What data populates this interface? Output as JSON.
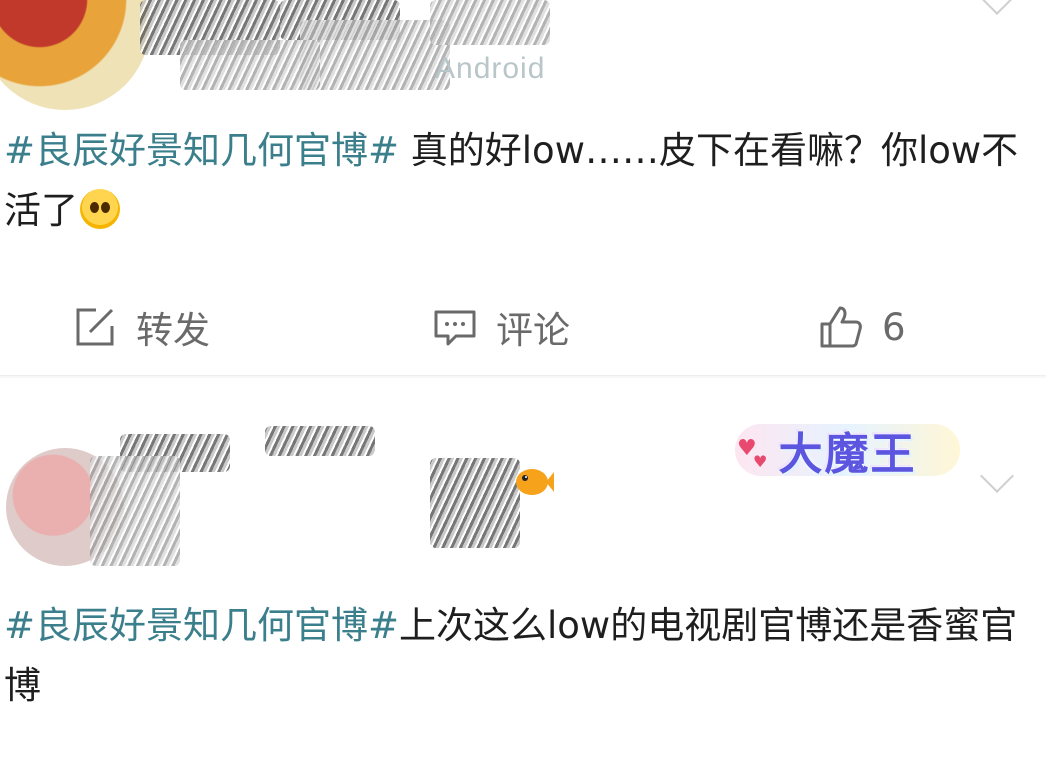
{
  "post1": {
    "source": "Android",
    "content_topic": "#良辰好景知几何官博#",
    "content_text": " 真的好low……皮下在看嘛？你low不活了",
    "actions": {
      "repost_label": "转发",
      "comment_label": "评论",
      "like_count": "6"
    }
  },
  "post2": {
    "badge_text": "大魔王",
    "content_topic": "#良辰好景知几何官博#",
    "content_text": "上次这么low的电视剧官博还是香蜜官博"
  },
  "icons": [
    "repost-icon",
    "comment-icon",
    "like-icon",
    "chevron-down-icon",
    "emoji-icon",
    "fish-emoji-icon"
  ],
  "colors": {
    "topic": "#3b7f8c",
    "text": "#1e1e1e",
    "action": "#6a6a6a",
    "source": "#b8c6c9"
  }
}
